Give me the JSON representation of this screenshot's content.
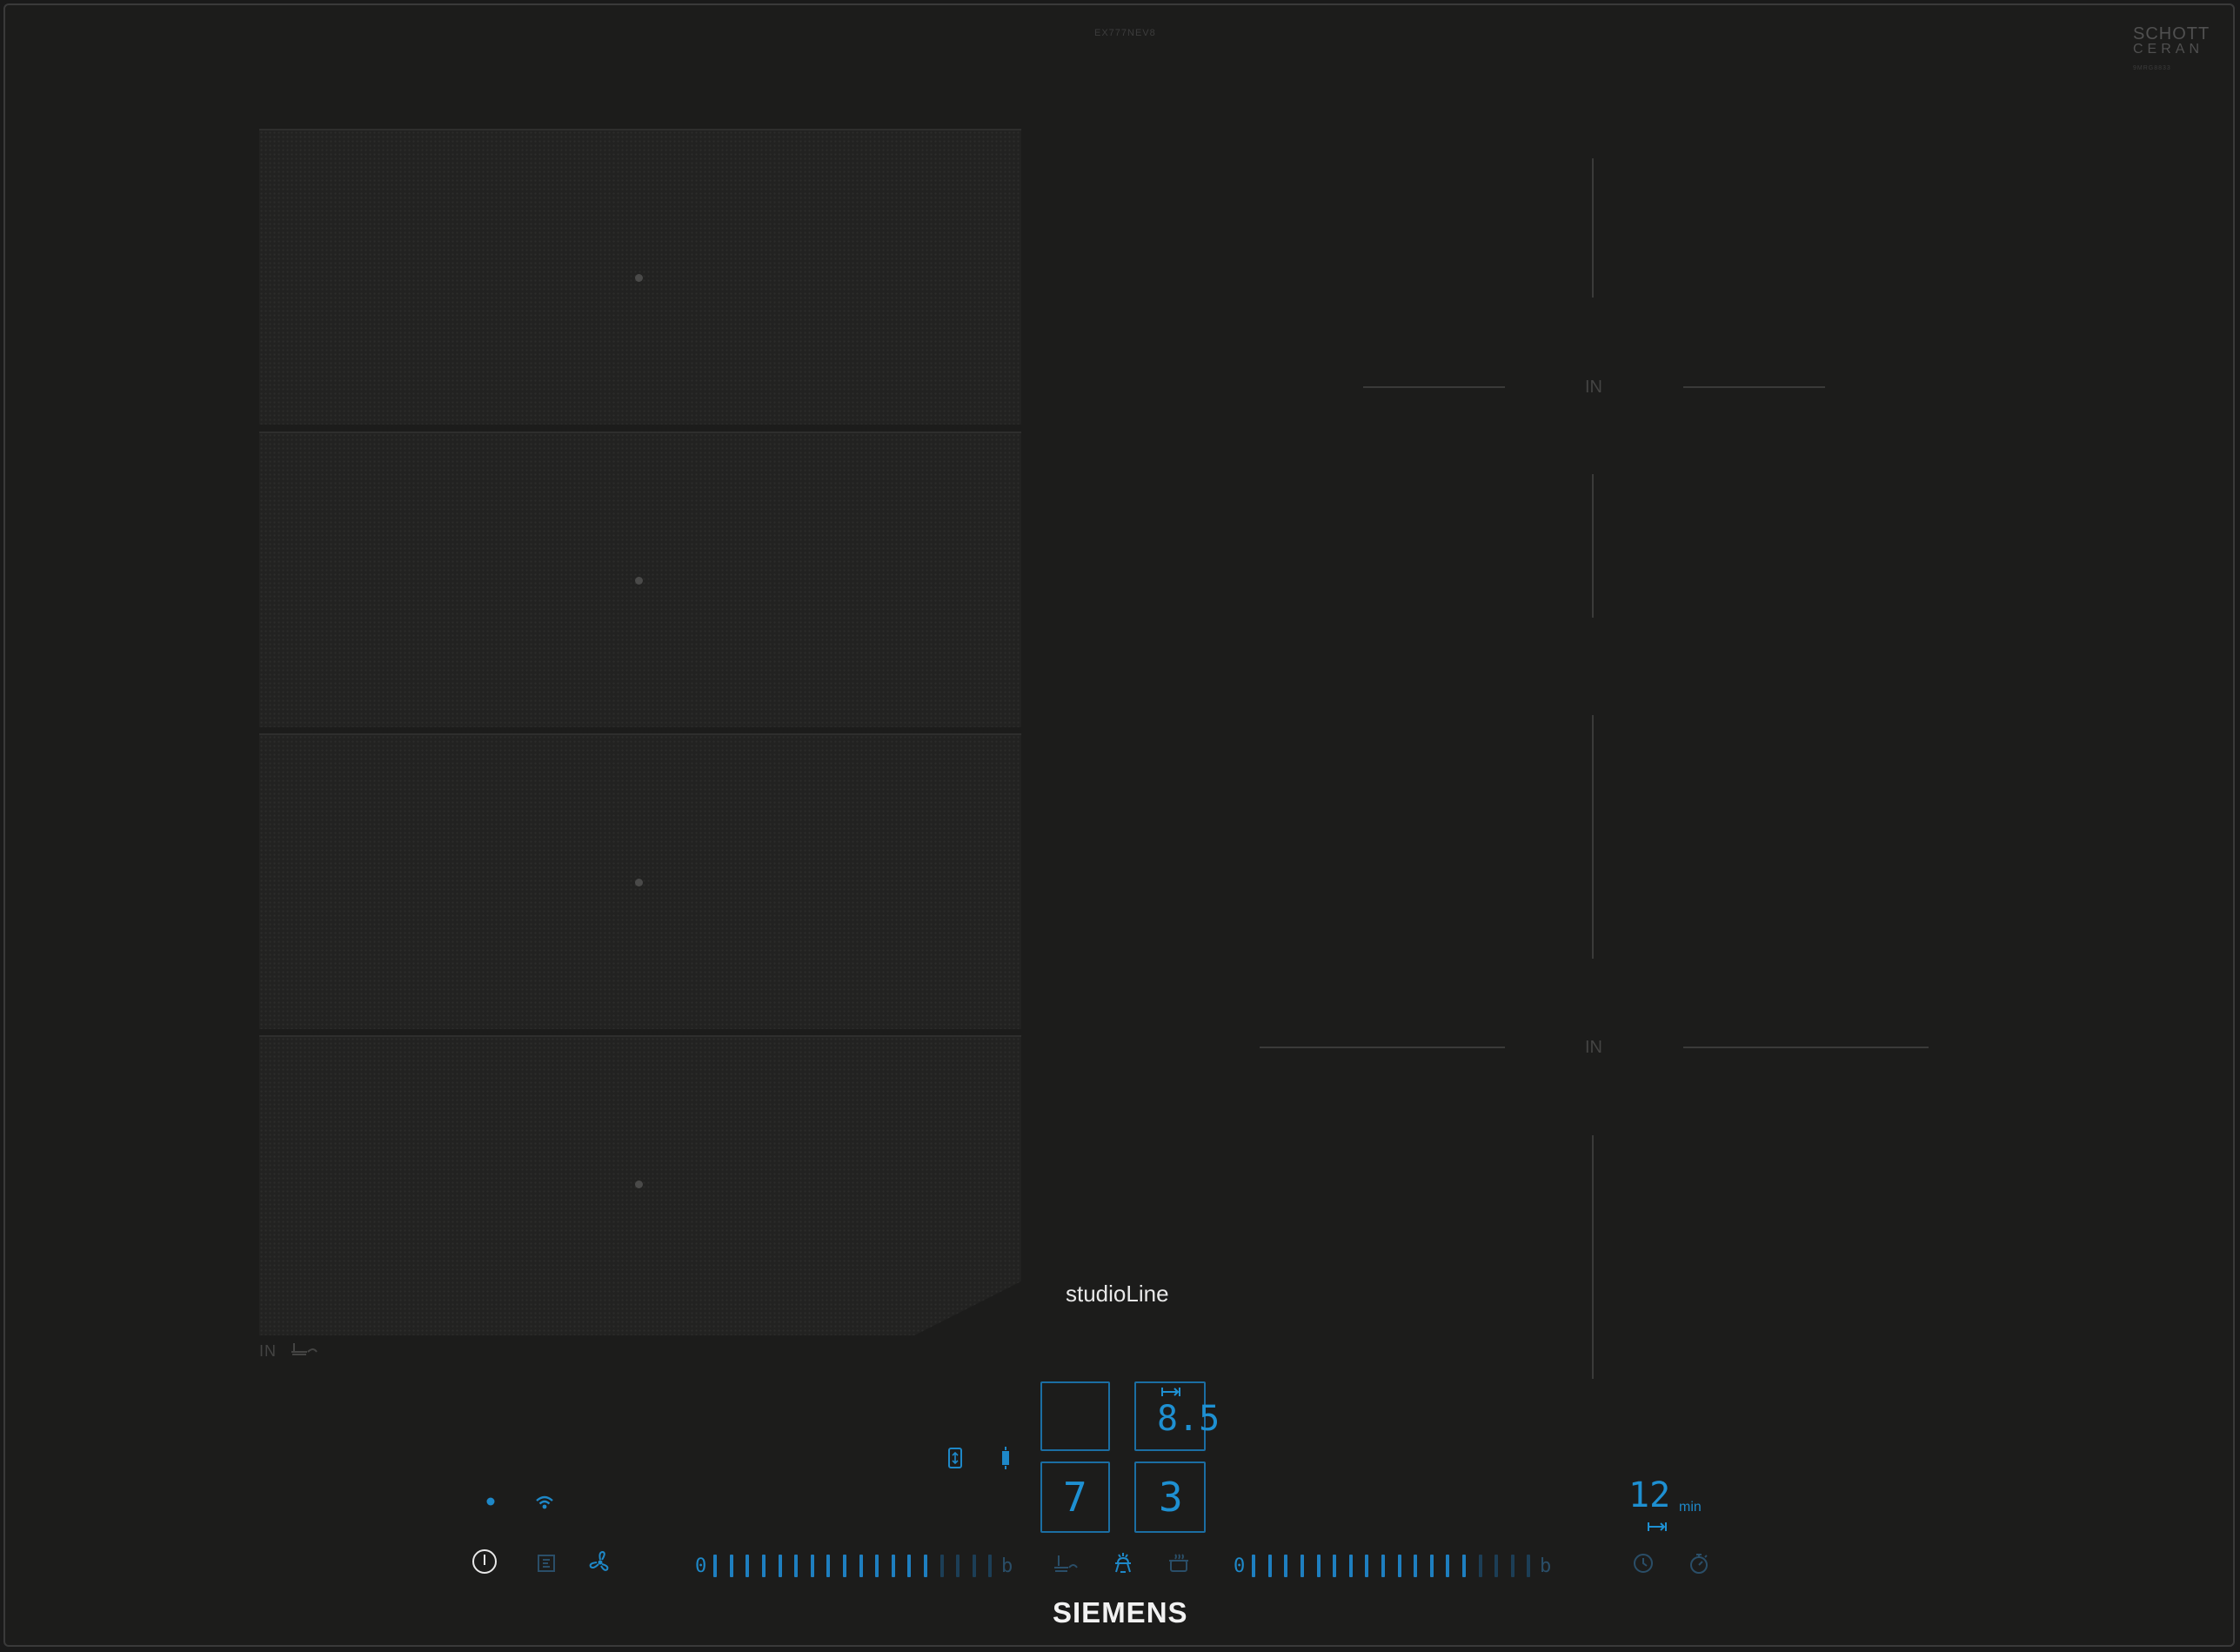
{
  "model_code": "EX777NEV8",
  "glass_brand": {
    "line1": "SCHOTT",
    "line2": "CERAN",
    "line3": "9MRG8833"
  },
  "flex_zone": {
    "label": "IN",
    "zones": 4
  },
  "right_zones": {
    "top_label": "IN",
    "bottom_label": "IN"
  },
  "product_line": "studioLine",
  "brand": "SIEMENS",
  "display": {
    "left_top": "",
    "left_bottom": "7",
    "right_top": "8.5",
    "right_bottom": "3"
  },
  "left_slider": {
    "start": "0",
    "end": "b",
    "active_ticks": 14,
    "total_ticks": 18
  },
  "right_slider": {
    "start": "0",
    "end": "b",
    "active_ticks": 14,
    "total_ticks": 18
  },
  "timer": {
    "value": "12",
    "unit": "min"
  },
  "icons": {
    "power": "power-icon",
    "home_connect": "home-connect-icon",
    "wifi": "wifi-icon",
    "hood": "hood-icon",
    "fan": "fan-icon",
    "flex": "flex-zone-icon",
    "move": "move-mode-icon",
    "frying": "frying-sensor-icon",
    "cooking_sensor": "cooking-sensor-icon",
    "keep_warm": "keep-warm-icon",
    "clock": "clock-icon",
    "stopwatch": "stopwatch-icon"
  },
  "colors": {
    "accent": "#1e88c8",
    "background": "#1c1c1b"
  }
}
